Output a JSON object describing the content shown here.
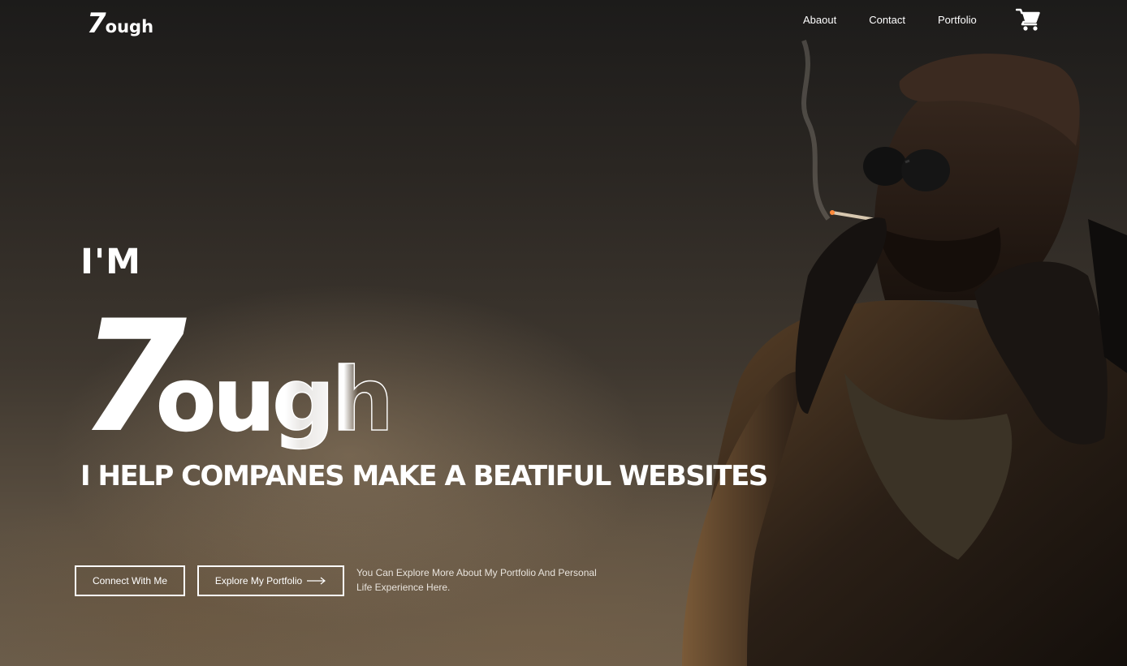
{
  "header": {
    "logo_number": "7",
    "logo_rest": "ough",
    "nav": [
      "Abaout",
      "Contact",
      "Portfolio"
    ],
    "cart_icon": "shopping-cart-icon"
  },
  "hero": {
    "intro": "I'M",
    "name_number": "7",
    "name_rest": "ough",
    "tagline": "I HELP COMPANES MAKE A BEATIFUL WEBSITES",
    "buttons": {
      "connect": "Connect With Me",
      "explore": "Explore My Portfolio",
      "explore_icon": "long-arrow-right-icon"
    },
    "hint": "You Can Explore More About My Portfolio And Personal Life Experience Here."
  },
  "colors": {
    "text": "#ffffff",
    "background_dark": "#1c1b1a",
    "background_warm": "#6b5d4b"
  }
}
